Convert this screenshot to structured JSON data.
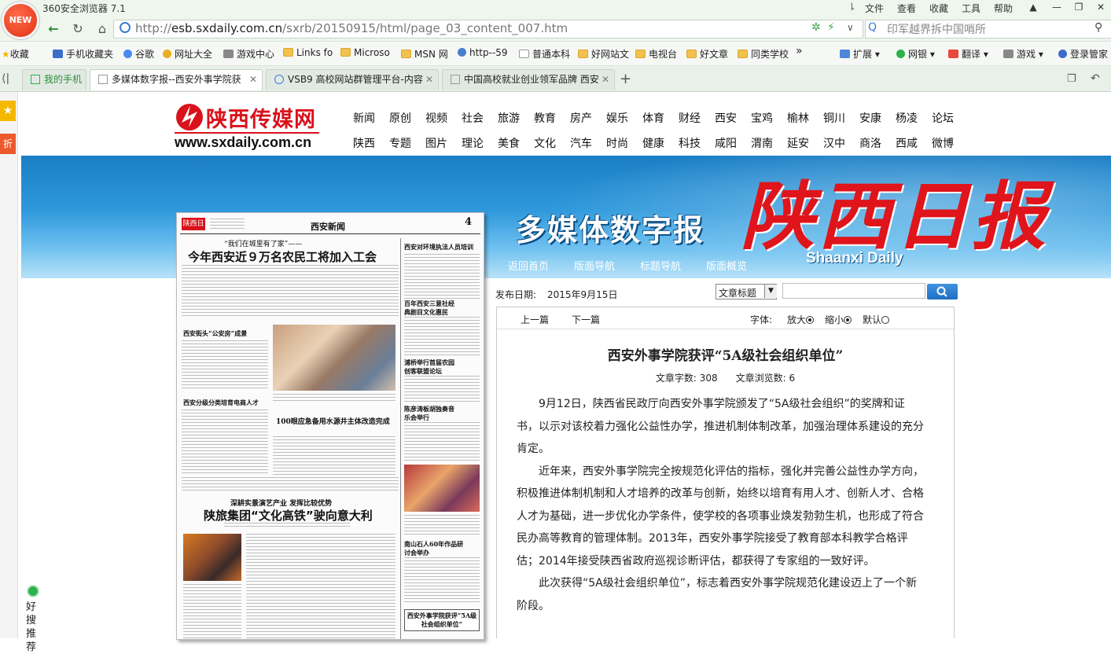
{
  "browser": {
    "app_title": "360安全浏览器 7.1",
    "logo_label": "NEW",
    "menu": [
      "文件",
      "查看",
      "收藏",
      "工具",
      "帮助"
    ],
    "address": {
      "scheme": "http://",
      "domain": "esb.sxdaily.com.cn",
      "path": "/sxrb/20150915/html/page_03_content_007.htm"
    },
    "search_placeholder": "印军越界拆中国哨所",
    "bookmarks": [
      "收藏",
      "手机收藏夹",
      "谷歌",
      "网址大全",
      "游戏中心",
      "Links fo",
      "Microso",
      "MSN 网",
      "http--59",
      "普通本科",
      "好网站文",
      "电视台",
      "好文章",
      "同类学校"
    ],
    "bookmark_more": "»",
    "right_tools": [
      "扩展",
      "网银",
      "翻译",
      "游戏",
      "登录管家"
    ],
    "tabs": [
      {
        "label": "我的手机",
        "active": false
      },
      {
        "label": "多媒体数字报--西安外事学院获",
        "active": true
      },
      {
        "label": "VSB9 高校网站群管理平台-内容",
        "active": false
      },
      {
        "label": "中国高校就业创业领军品牌 西安",
        "active": false
      }
    ],
    "new_tab": "+"
  },
  "sidebar": {
    "fav_icon": "star-icon",
    "discount_label": "折",
    "recommend_label": "好搜推荐"
  },
  "site": {
    "logo_text": "陕西传媒网",
    "logo_url": "www.sxdaily.com.cn",
    "nav_row1": [
      "新闻",
      "原创",
      "视频",
      "社会",
      "旅游",
      "教育",
      "房产",
      "娱乐",
      "体育",
      "财经",
      "西安",
      "宝鸡",
      "榆林",
      "铜川",
      "安康",
      "杨凌",
      "论坛"
    ],
    "nav_row2": [
      "陕西",
      "专题",
      "图片",
      "理论",
      "美食",
      "文化",
      "汽车",
      "时尚",
      "健康",
      "科技",
      "咸阳",
      "渭南",
      "延安",
      "汉中",
      "商洛",
      "西咸",
      "微博"
    ],
    "banner_subtitle": "多媒体数字报",
    "banner_title": "陕西日报",
    "banner_english": "Shaanxi Daily",
    "banner_nav": [
      "返回首页",
      "版面导航",
      "标题导航",
      "版面概览"
    ]
  },
  "paper": {
    "masthead": "陕西日报",
    "section": "西安新闻",
    "page_no": "4",
    "kicker": "“我们在城里有了家”——",
    "headline": "今年西安近９万名农民工将加入工会",
    "side_heads": [
      "西安对环境执法人员培训",
      "百年西安三意社经典剧目文化惠民",
      "浦桥举行首届农园创客联盟论坛",
      "陈彦涛板胡独奏音乐会举行",
      "南山石人60年作品研讨会举办"
    ],
    "sub_heads": [
      "西安街头“公安房”成景",
      "西安分级分类培育电商人才",
      "100眼应急备用水源井主体改造完成"
    ],
    "feature_kicker": "深耕实景演艺产业 发挥比较优势",
    "feature_headline": "陕旅集团“文化高铁”驶向意大利",
    "bottom_box": "西安外事学院获评“5A级社会组织单位”"
  },
  "article": {
    "pub_label": "发布日期:",
    "pub_date": "2015年9月15日",
    "search_scope": "文章标题",
    "prev": "上一篇",
    "next": "下一篇",
    "font_label": "字体:",
    "font_options": [
      "放大",
      "缩小",
      "默认"
    ],
    "title": "西安外事学院获评“5A级社会组织单位”",
    "word_count_label": "文章字数:",
    "word_count": "308",
    "views_label": "文章浏览数:",
    "views": "6",
    "paragraphs": [
      "9月12日，陕西省民政厅向西安外事学院颁发了“5A级社会组织”的奖牌和证书，以示对该校着力强化公益性办学，推进机制体制改革，加强治理体系建设的充分肯定。",
      "近年来，西安外事学院完全按规范化评估的指标，强化并完善公益性办学方向，积极推进体制机制和人才培养的改革与创新，始终以培育有用人才、创新人才、合格人才为基础，进一步优化办学条件，使学校的各项事业焕发勃勃生机，也形成了符合民办高等教育的管理体制。2013年，西安外事学院接受了教育部本科教学合格评估；2014年接受陕西省政府巡视诊断评估，都获得了专家组的一致好评。",
      "此次获得“5A级社会组织单位”，标志着西安外事学院规范化建设迈上了一个新阶段。"
    ]
  }
}
